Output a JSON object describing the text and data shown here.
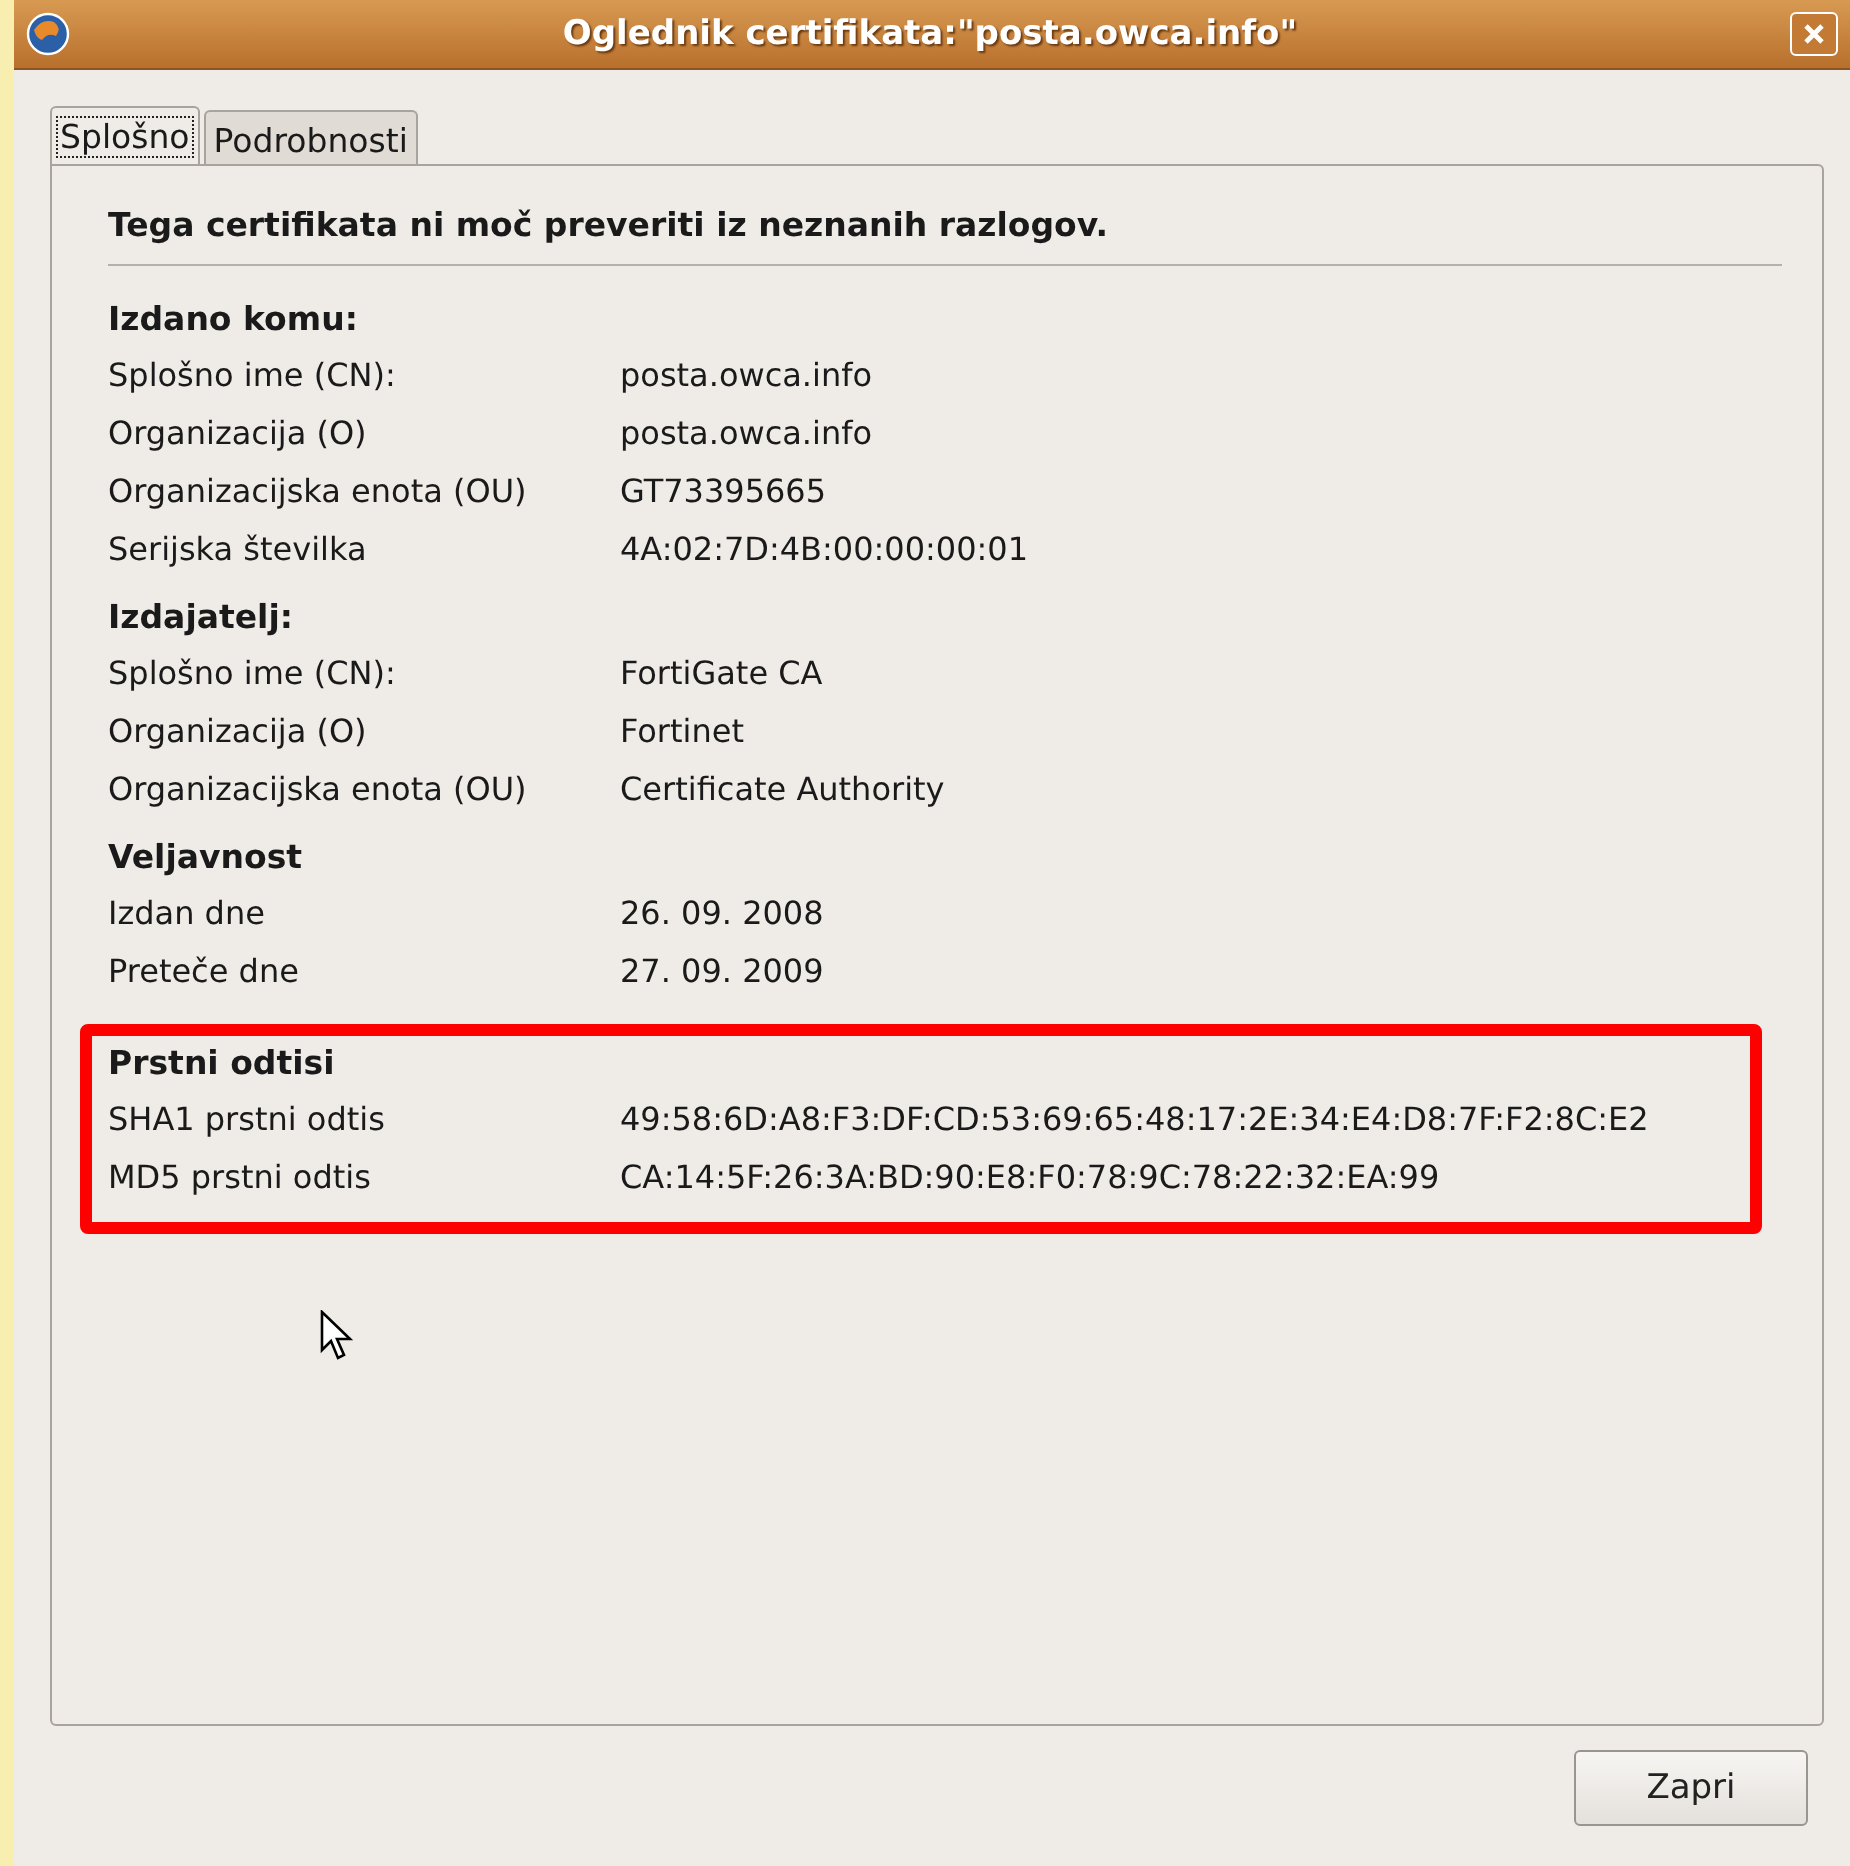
{
  "window": {
    "title": "Oglednik certifikata:\"posta.owca.info\""
  },
  "tabs": [
    {
      "label": "Splošno",
      "selected": true
    },
    {
      "label": "Podrobnosti",
      "selected": false
    }
  ],
  "message": "Tega certifikata ni moč preveriti iz neznanih razlogov.",
  "sections": [
    {
      "heading": "Izdano komu:",
      "highlighted": false,
      "rows": [
        {
          "label": "Splošno ime (CN):",
          "value": "posta.owca.info"
        },
        {
          "label": "Organizacija (O)",
          "value": "posta.owca.info"
        },
        {
          "label": "Organizacijska enota (OU)",
          "value": "GT73395665"
        },
        {
          "label": "Serijska številka",
          "value": "4A:02:7D:4B:00:00:00:01"
        }
      ]
    },
    {
      "heading": "Izdajatelj:",
      "highlighted": false,
      "rows": [
        {
          "label": "Splošno ime (CN):",
          "value": "FortiGate CA"
        },
        {
          "label": "Organizacija (O)",
          "value": "Fortinet"
        },
        {
          "label": "Organizacijska enota (OU)",
          "value": "Certificate Authority"
        }
      ]
    },
    {
      "heading": "Veljavnost",
      "highlighted": false,
      "rows": [
        {
          "label": "Izdan dne",
          "value": "26. 09. 2008"
        },
        {
          "label": "Preteče dne",
          "value": "27. 09. 2009"
        }
      ]
    },
    {
      "heading": "Prstni odtisi",
      "highlighted": true,
      "rows": [
        {
          "label": "SHA1 prstni odtis",
          "value": "49:58:6D:A8:F3:DF:CD:53:69:65:48:17:2E:34:E4:D8:7F:F2:8C:E2"
        },
        {
          "label": "MD5 prstni odtis",
          "value": "CA:14:5F:26:3A:BD:90:E8:F0:78:9C:78:22:32:EA:99"
        }
      ]
    }
  ],
  "buttons": [
    "Zapri"
  ]
}
